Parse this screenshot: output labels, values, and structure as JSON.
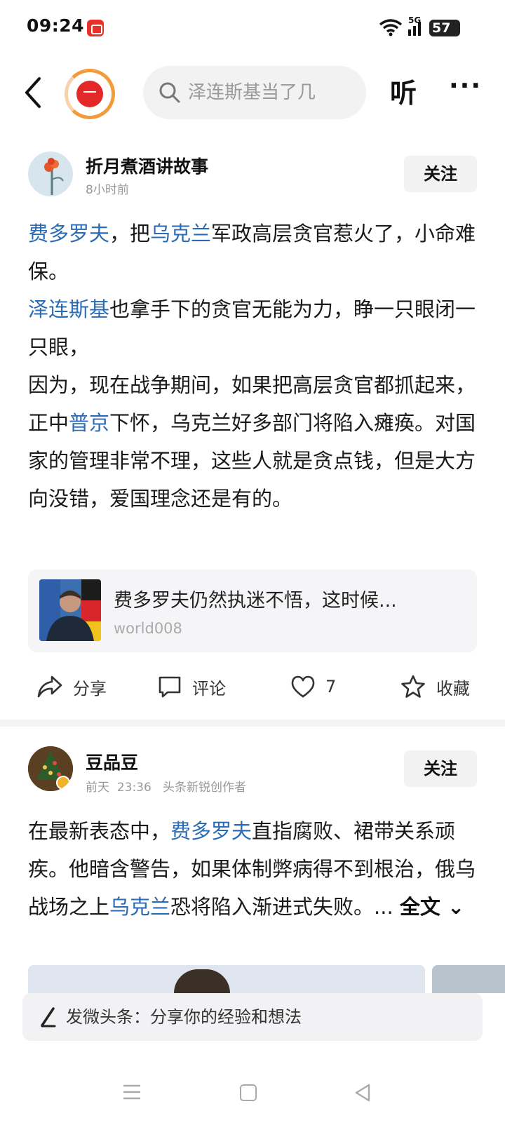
{
  "status_bar": {
    "time": "09:24",
    "network": "5G",
    "battery": "57"
  },
  "top_nav": {
    "search_text": "泽连斯基当了几",
    "listen_label": "听",
    "more_label": "···"
  },
  "posts": [
    {
      "author": "折月煮酒讲故事",
      "meta": "8小时前",
      "follow_label": "关注",
      "body": [
        [
          {
            "t": "费多罗夫",
            "hl": true
          },
          {
            "t": "，把"
          },
          {
            "t": "乌克兰",
            "hl": true
          },
          {
            "t": "军政高层贪官惹火了，小命难保。"
          }
        ],
        [
          {
            "t": "泽连斯基",
            "hl": true
          },
          {
            "t": "也拿手下的贪官无能为力，睁一只眼闭一只眼，"
          }
        ],
        [
          {
            "t": "因为，现在战争期间，如果把高层贪官都抓起来，正中"
          },
          {
            "t": "普京",
            "hl": true
          },
          {
            "t": "下怀，乌克兰好多部门将陷入瘫痪。对国家的管理非常不理，这些人就是贪点钱，但是大方向没错，爱国理念还是有的。"
          }
        ]
      ],
      "link_card": {
        "title": "费多罗夫仍然执迷不悟，这时候...",
        "source": "world008"
      },
      "actions": {
        "share": "分享",
        "comment": "评论",
        "like_count": "7",
        "favorite": "收藏"
      }
    },
    {
      "author": "豆品豆",
      "meta_date": "前天",
      "meta_time": "23:36",
      "meta_badge": "头条新锐创作者",
      "follow_label": "关注",
      "body": [
        [
          {
            "t": "在最新表态中，"
          },
          {
            "t": "费多罗夫",
            "hl": true
          },
          {
            "t": "直指腐败、裙带关系顽疾。他暗含警告，如果体制弊病得不到根治，俄乌战场之上"
          },
          {
            "t": "乌克兰",
            "hl": true
          },
          {
            "t": "恐将陷入渐进式失败。... "
          }
        ]
      ],
      "read_full_label": "全文"
    }
  ],
  "composer": {
    "placeholder": "发微头条：分享你的经验和想法"
  },
  "icons": {
    "back": "chevron-left-icon",
    "search": "search-icon",
    "share": "share-icon",
    "comment": "comment-icon",
    "like": "heart-icon",
    "favorite": "star-icon",
    "composer": "pen-icon"
  },
  "colors": {
    "accent_link": "#2a6bb5",
    "logo_red": "#e42828",
    "logo_ring": "#f29b3b"
  }
}
